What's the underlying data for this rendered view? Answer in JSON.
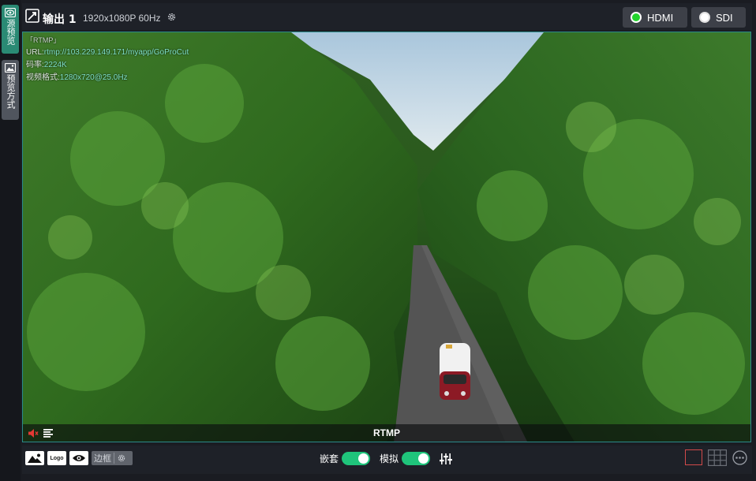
{
  "sidebar": {
    "tabs": [
      {
        "label": "源预览",
        "icon": "eye-icon",
        "active": true
      },
      {
        "label": "预览方式",
        "icon": "image-icon",
        "active": false
      }
    ]
  },
  "header": {
    "icon": "edit-icon",
    "title": "输出 1",
    "resolution": "1920x1080P 60Hz",
    "outputs": [
      {
        "label": "HDMI",
        "status_color": "#22d42c"
      },
      {
        "label": "SDI",
        "status_color": "#ffffff"
      }
    ]
  },
  "preview": {
    "tag": "「RTMP」",
    "url_label": "URL:",
    "url": "rtmp://103.229.149.171/myapp/GoProCut",
    "bitrate_label": "码率:",
    "bitrate": "2224K",
    "format_label": "视频格式:",
    "format": "1280x720@25.0Hz",
    "stream_name": "RTMP",
    "muted": true
  },
  "toolbar": {
    "logo_label": "Logo",
    "border_label": "边框",
    "nest_label": "嵌套",
    "nest_on": true,
    "analog_label": "模拟",
    "analog_on": true
  },
  "colors": {
    "accent": "#1fc47b",
    "active_tab": "#2a8a74",
    "frame_border": "#2a8a8a",
    "layout_selected": "#d24a4a"
  }
}
